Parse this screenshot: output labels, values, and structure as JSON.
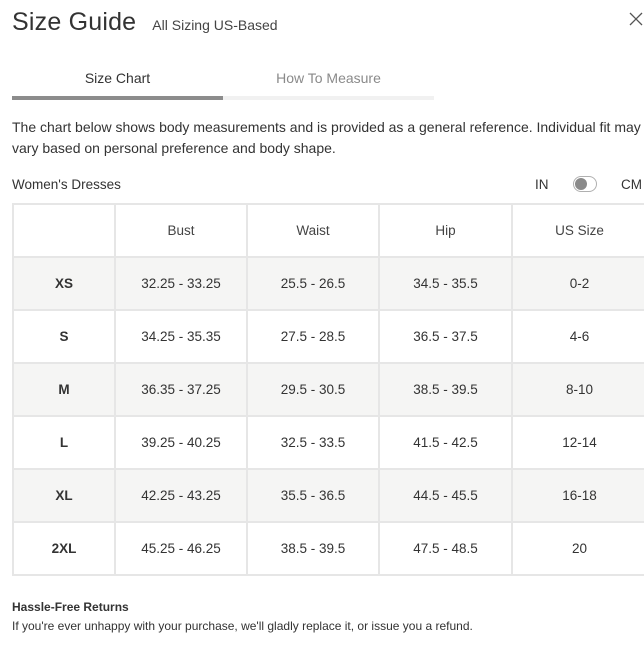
{
  "header": {
    "title": "Size Guide",
    "subtitle": "All Sizing US-Based",
    "close_icon": "close-icon"
  },
  "tabs": [
    {
      "label": "Size Chart",
      "active": true
    },
    {
      "label": "How To Measure",
      "active": false
    }
  ],
  "description": "The chart below shows body measurements and is provided as a general reference. Individual fit may vary based on personal preference and body shape.",
  "section": {
    "label": "Women's Dresses",
    "unit_in": "IN",
    "unit_cm": "CM",
    "selected_unit": "IN"
  },
  "table": {
    "columns": [
      "",
      "Bust",
      "Waist",
      "Hip",
      "US Size"
    ],
    "rows": [
      {
        "size": "XS",
        "bust": "32.25 - 33.25",
        "waist": "25.5 - 26.5",
        "hip": "34.5 - 35.5",
        "us": "0-2"
      },
      {
        "size": "S",
        "bust": "34.25 - 35.35",
        "waist": "27.5 - 28.5",
        "hip": "36.5 - 37.5",
        "us": "4-6"
      },
      {
        "size": "M",
        "bust": "36.35 - 37.25",
        "waist": "29.5 - 30.5",
        "hip": "38.5 - 39.5",
        "us": "8-10"
      },
      {
        "size": "L",
        "bust": "39.25 - 40.25",
        "waist": "32.5 - 33.5",
        "hip": "41.5 - 42.5",
        "us": "12-14"
      },
      {
        "size": "XL",
        "bust": "42.25 - 43.25",
        "waist": "35.5 - 36.5",
        "hip": "44.5 - 45.5",
        "us": "16-18"
      },
      {
        "size": "2XL",
        "bust": "45.25 - 46.25",
        "waist": "38.5 - 39.5",
        "hip": "47.5 - 48.5",
        "us": "20"
      }
    ]
  },
  "footer": {
    "title": "Hassle-Free Returns",
    "text": "If you're ever unhappy with your purchase, we'll gladly replace it, or issue you a refund."
  },
  "colors": {
    "text": "#333333",
    "muted": "#8a8a8a",
    "border": "#e6e6e6",
    "row_shade": "#f5f5f4",
    "tab_indicator": "#8c8c8c"
  }
}
